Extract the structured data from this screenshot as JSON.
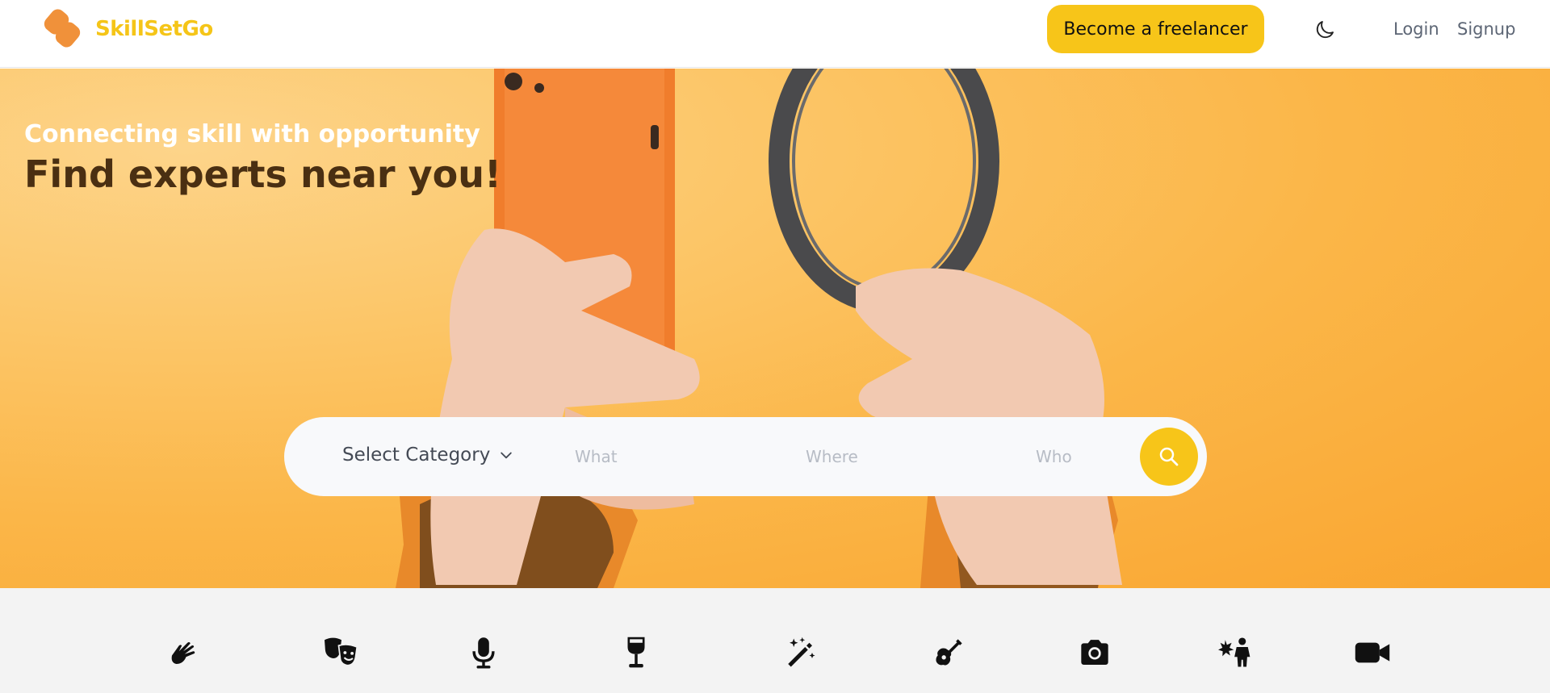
{
  "header": {
    "brand_name": "SkillSetGo",
    "freelancer_button": "Become a freelancer",
    "theme_toggle_icon": "moon-icon",
    "login": "Login",
    "signup": "Signup"
  },
  "hero": {
    "tagline": "Connecting skill with opportunity",
    "title": "Find experts near you!"
  },
  "search": {
    "category_label": "Select Category",
    "what_placeholder": "What",
    "where_placeholder": "Where",
    "who_placeholder": "Who",
    "button_icon": "search-icon"
  },
  "categories": [
    {
      "icon": "sign-language-icon"
    },
    {
      "icon": "theater-masks-icon"
    },
    {
      "icon": "microphone-icon"
    },
    {
      "icon": "wine-glass-icon"
    },
    {
      "icon": "magic-wand-icon"
    },
    {
      "icon": "guitar-icon"
    },
    {
      "icon": "camera-icon"
    },
    {
      "icon": "child-sparkle-icon"
    },
    {
      "icon": "video-camera-icon"
    }
  ],
  "colors": {
    "brand_yellow": "#f7c519",
    "brand_orange": "#f0913a",
    "hero_orange": "#fbb648",
    "title_brown": "#4a2f12"
  }
}
